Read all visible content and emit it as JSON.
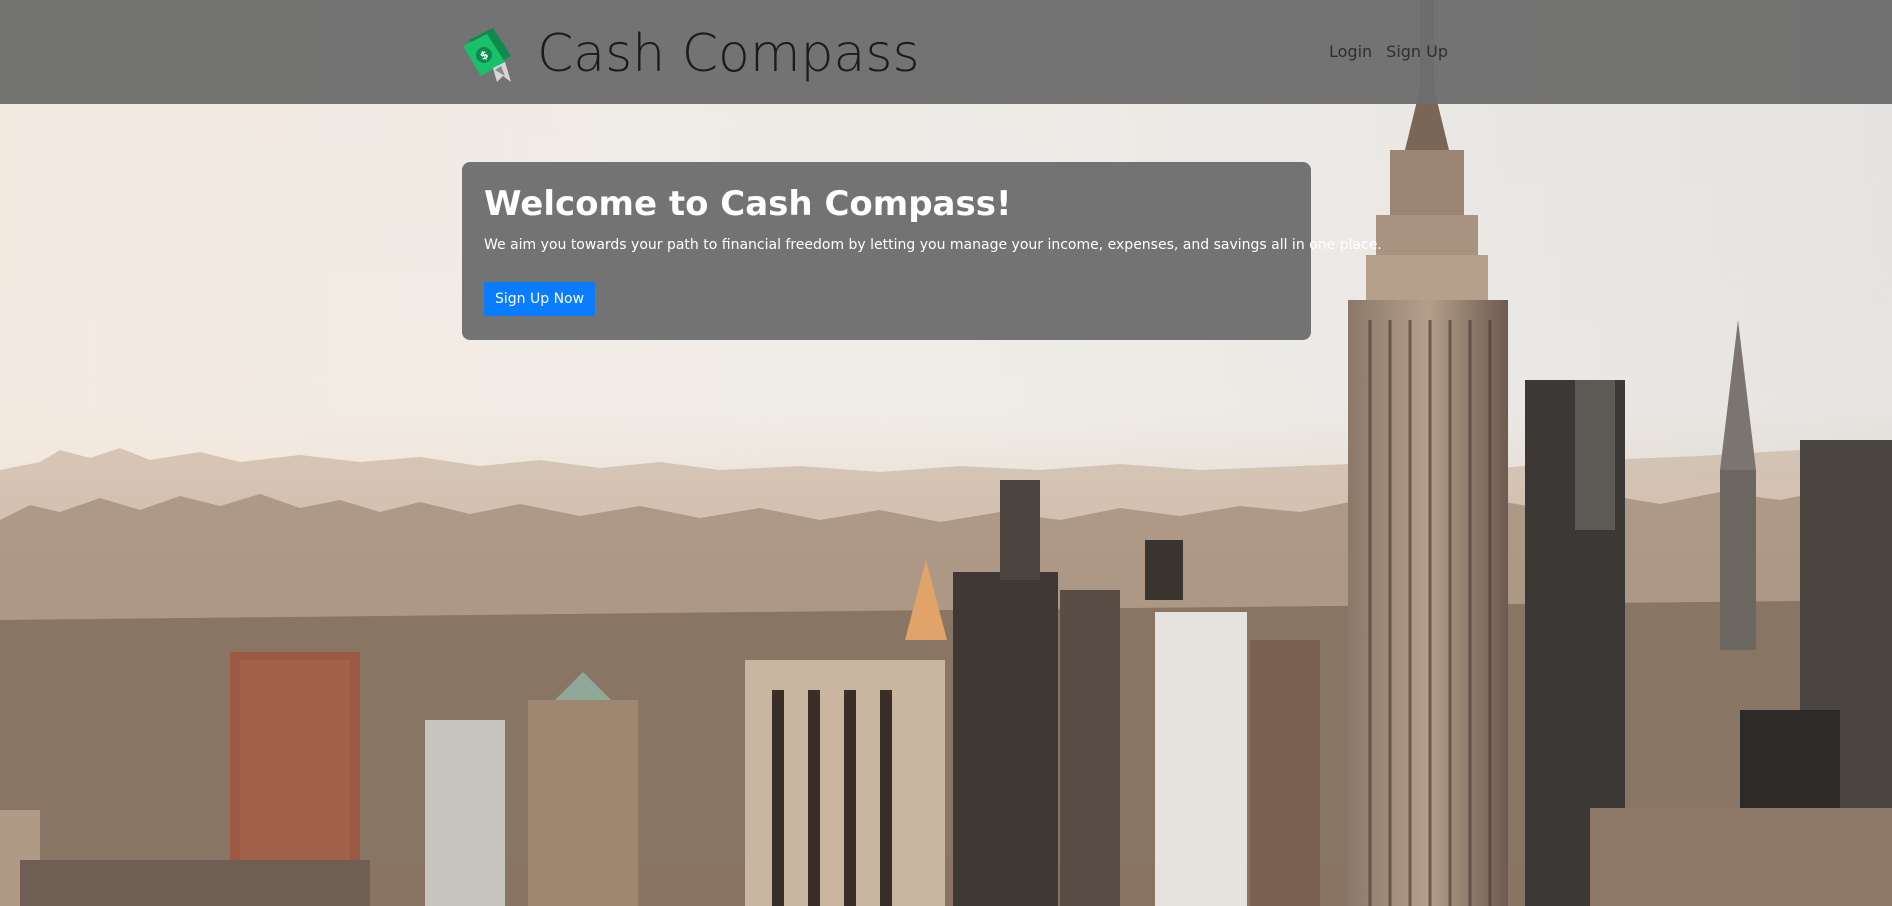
{
  "brand": {
    "name": "Cash Compass",
    "logo_icon": "money-bill-icon"
  },
  "nav": {
    "login_label": "Login",
    "signup_label": "Sign Up"
  },
  "hero": {
    "title": "Welcome to Cash Compass!",
    "subtitle": "We aim you towards your path to financial freedom by letting you manage your income, expenses, and savings all in one place.",
    "cta_label": "Sign Up Now"
  },
  "colors": {
    "topbar": "#6e6e6e",
    "card": "#6e6e6e",
    "cta": "#0a7cff",
    "logo_green": "#19c26a"
  }
}
